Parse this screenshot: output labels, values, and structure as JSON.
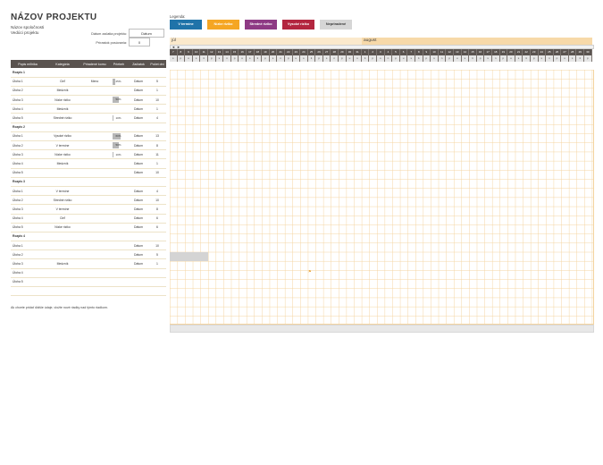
{
  "header": {
    "title": "NÁZOV PROJEKTU",
    "company": "Názov spoločnosti",
    "manager": "Vedúci projektu",
    "start_label": "Dátum začatia projektu:",
    "start_value": "Dátum",
    "week_label": "Prírastok posúvania:",
    "week_value": "0"
  },
  "legend": {
    "title": "Legenda:",
    "items": [
      {
        "label": "V termíne",
        "color": "#1f73a9"
      },
      {
        "label": "Nízke riziko",
        "color": "#f5a623"
      },
      {
        "label": "Stredné riziko",
        "color": "#8e3a84"
      },
      {
        "label": "Vysoké riziko",
        "color": "#b3263f"
      },
      {
        "label": "Nepriradené",
        "color": "#d6d6d6"
      }
    ]
  },
  "table": {
    "columns": [
      "Popis míľnika",
      "Kategória",
      "Priradené komu",
      "Priebeh",
      "Začiatok",
      "Počet dní"
    ],
    "rows": [
      {
        "type": "phase",
        "name": "Rozpis 1",
        "cat": "",
        "who": "",
        "progress": "",
        "start": "",
        "days": ""
      },
      {
        "type": "task",
        "name": "Úloha 1",
        "cat": "Cieľ",
        "who": "Meno",
        "progress": "25%",
        "start": "Dátum",
        "days": "5"
      },
      {
        "type": "task",
        "name": "Úloha 2",
        "cat": "Medzník",
        "who": "",
        "progress": "",
        "start": "Dátum",
        "days": "1"
      },
      {
        "type": "task",
        "name": "Úloha 3",
        "cat": "Nízke riziko",
        "who": "",
        "progress": "50%",
        "start": "Dátum",
        "days": "10"
      },
      {
        "type": "task",
        "name": "Úloha 4",
        "cat": "Medzník",
        "who": "",
        "progress": "",
        "start": "Dátum",
        "days": "1"
      },
      {
        "type": "task",
        "name": "Úloha 5",
        "cat": "Stredné riziko",
        "who": "",
        "progress": "10%",
        "start": "Dátum",
        "days": "4"
      },
      {
        "type": "phase",
        "name": "Rozpis 2",
        "cat": "",
        "who": "",
        "progress": "",
        "start": "",
        "days": ""
      },
      {
        "type": "task",
        "name": "Úloha 1",
        "cat": "Vysoké riziko",
        "who": "",
        "progress": "60%",
        "start": "Dátum",
        "days": "13"
      },
      {
        "type": "task",
        "name": "Úloha 2",
        "cat": "V termíne",
        "who": "",
        "progress": "50%",
        "start": "Dátum",
        "days": "8"
      },
      {
        "type": "task",
        "name": "Úloha 3",
        "cat": "Nízke riziko",
        "who": "",
        "progress": "10%",
        "start": "Dátum",
        "days": "11"
      },
      {
        "type": "task",
        "name": "Úloha 4",
        "cat": "Medzník",
        "who": "",
        "progress": "",
        "start": "Dátum",
        "days": "1"
      },
      {
        "type": "task",
        "name": "Úloha 5",
        "cat": "",
        "who": "",
        "progress": "",
        "start": "Dátum",
        "days": "10"
      },
      {
        "type": "phase",
        "name": "Rozpis 3",
        "cat": "",
        "who": "",
        "progress": "",
        "start": "",
        "days": ""
      },
      {
        "type": "task",
        "name": "Úloha 1",
        "cat": "V termíne",
        "who": "",
        "progress": "",
        "start": "Dátum",
        "days": "4"
      },
      {
        "type": "task",
        "name": "Úloha 2",
        "cat": "Stredné riziko",
        "who": "",
        "progress": "",
        "start": "Dátum",
        "days": "10"
      },
      {
        "type": "task",
        "name": "Úloha 3",
        "cat": "V termíne",
        "who": "",
        "progress": "",
        "start": "Dátum",
        "days": "8"
      },
      {
        "type": "task",
        "name": "Úloha 4",
        "cat": "Cieľ",
        "who": "",
        "progress": "",
        "start": "Dátum",
        "days": "6"
      },
      {
        "type": "task",
        "name": "Úloha 5",
        "cat": "Nízke riziko",
        "who": "",
        "progress": "",
        "start": "Dátum",
        "days": "6"
      },
      {
        "type": "phase",
        "name": "Rozpis 4",
        "cat": "",
        "who": "",
        "progress": "",
        "start": "",
        "days": ""
      },
      {
        "type": "task",
        "name": "Úloha 1",
        "cat": "",
        "who": "",
        "progress": "",
        "start": "Dátum",
        "days": "10"
      },
      {
        "type": "task",
        "name": "Úloha 2",
        "cat": "",
        "who": "",
        "progress": "",
        "start": "Dátum",
        "days": "5"
      },
      {
        "type": "task",
        "name": "Úloha 3",
        "cat": "Medzník",
        "who": "",
        "progress": "",
        "start": "Dátum",
        "days": "1"
      },
      {
        "type": "task",
        "name": "Úloha 4",
        "cat": "",
        "who": "",
        "progress": "",
        "start": "",
        "days": ""
      },
      {
        "type": "task",
        "name": "Úloha 5",
        "cat": "",
        "who": "",
        "progress": "",
        "start": "",
        "days": ""
      },
      {
        "type": "task",
        "name": "",
        "cat": "",
        "who": "",
        "progress": "",
        "start": "",
        "days": ""
      }
    ]
  },
  "footnote": "Ak chcete pridať ďalšie údaje, vložte nové riadky nad týmto riadkom.",
  "gantt": {
    "months": [
      {
        "label": "júl",
        "days": 25
      },
      {
        "label": "august",
        "days": 30
      }
    ],
    "days": [
      "7",
      "8",
      "9",
      "10",
      "11",
      "12",
      "13",
      "14",
      "15",
      "16",
      "17",
      "18",
      "19",
      "20",
      "21",
      "22",
      "23",
      "24",
      "25",
      "26",
      "27",
      "28",
      "29",
      "30",
      "31",
      "1",
      "2",
      "3",
      "4",
      "5",
      "6",
      "7",
      "8",
      "9",
      "10",
      "11",
      "12",
      "13",
      "14",
      "15",
      "16",
      "17",
      "18",
      "19",
      "20",
      "21",
      "22",
      "23",
      "24",
      "25",
      "26",
      "27",
      "28",
      "29",
      "30"
    ],
    "weekdays": [
      "s",
      "p",
      "u",
      "s",
      "š",
      "p",
      "s",
      "n",
      "p",
      "u",
      "s",
      "š",
      "p",
      "s",
      "n",
      "p",
      "u",
      "s",
      "š",
      "p",
      "s",
      "n",
      "p",
      "u",
      "s",
      "š",
      "p",
      "s",
      "n",
      "p",
      "u",
      "s",
      "š",
      "p",
      "s",
      "n",
      "p",
      "u",
      "s",
      "š",
      "p",
      "s",
      "n",
      "p",
      "u",
      "s",
      "š",
      "p",
      "s",
      "n",
      "p",
      "u",
      "s",
      "š",
      "p"
    ],
    "scroll_left": "◄",
    "scroll_right": "►"
  }
}
